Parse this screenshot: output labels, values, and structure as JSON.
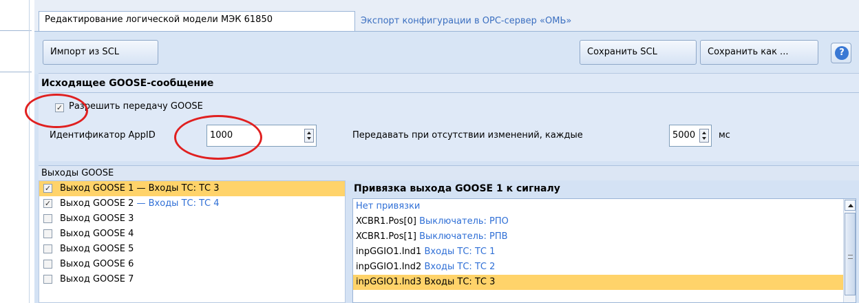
{
  "tabs": {
    "active": "Редактирование логической модели МЭК 61850",
    "inactive": "Экспорт конфигурации в OPC-сервер «ОМЬ»"
  },
  "toolbar": {
    "import_label": "Импорт из SCL",
    "save_label": "Сохранить SCL",
    "save_as_label": "Сохранить как ...",
    "help_label": "?"
  },
  "goose_out": {
    "title": "Исходящее GOOSE-сообщение",
    "enable_label": "Разрешить передачу GOOSE",
    "enable_checked": true,
    "appid_label": "Идентификатор AppID",
    "appid_value": "1000",
    "interval_label": "Передавать при отсутствии изменений, каждые",
    "interval_value": "5000",
    "interval_unit": "мс"
  },
  "outputs": {
    "header": "Выходы GOOSE",
    "items": [
      {
        "label": "Выход GOOSE 1",
        "suffix": " — Входы ТС: ТС 3",
        "checked": true,
        "selected": true
      },
      {
        "label": "Выход GOOSE 2",
        "suffix": " — Входы ТС: ТС 4",
        "checked": true,
        "selected": false
      },
      {
        "label": "Выход GOOSE 3",
        "suffix": "",
        "checked": false,
        "selected": false
      },
      {
        "label": "Выход GOOSE 4",
        "suffix": "",
        "checked": false,
        "selected": false
      },
      {
        "label": "Выход GOOSE 5",
        "suffix": "",
        "checked": false,
        "selected": false
      },
      {
        "label": "Выход GOOSE 6",
        "suffix": "",
        "checked": false,
        "selected": false
      },
      {
        "label": "Выход GOOSE 7",
        "suffix": "",
        "checked": false,
        "selected": false
      }
    ]
  },
  "binding": {
    "title": "Привязка выхода GOOSE 1 к сигналу",
    "rows": [
      {
        "ref": "",
        "desc": "Нет привязки",
        "selected": false
      },
      {
        "ref": "XCBR1.Pos[0]",
        "desc": "Выключатель: РПО",
        "selected": false
      },
      {
        "ref": "XCBR1.Pos[1]",
        "desc": "Выключатель: РПВ",
        "selected": false
      },
      {
        "ref": "inpGGIO1.Ind1",
        "desc": "Входы ТС: ТС 1",
        "selected": false
      },
      {
        "ref": "inpGGIO1.Ind2",
        "desc": "Входы ТС: ТС 2",
        "selected": false
      },
      {
        "ref": "inpGGIO1.Ind3",
        "desc": "Входы ТС: ТС 3",
        "selected": true
      }
    ]
  },
  "colors": {
    "accent_link": "#2f6fd6",
    "selected_row": "#ffd36a",
    "annotation_red": "#e02020"
  }
}
